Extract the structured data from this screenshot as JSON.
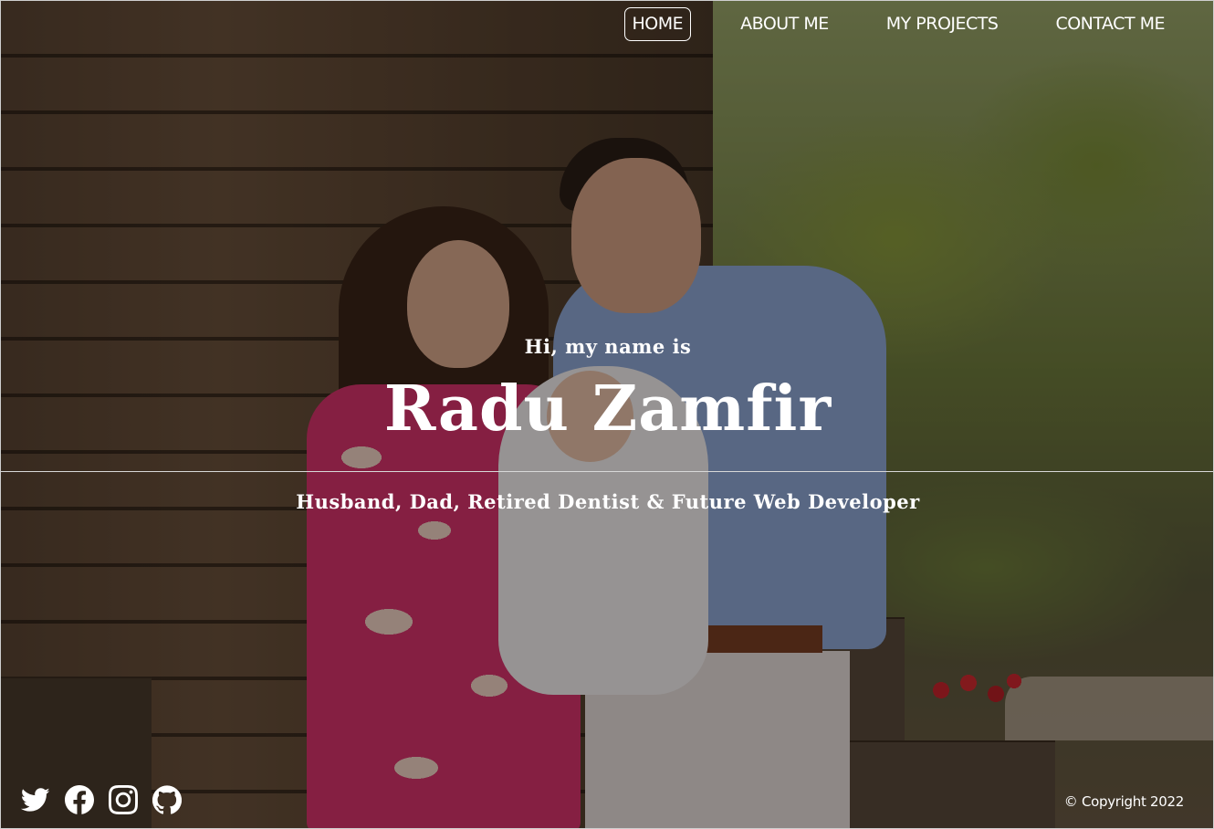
{
  "nav": {
    "items": [
      {
        "label": "HOME",
        "active": true
      },
      {
        "label": "ABOUT ME",
        "active": false
      },
      {
        "label": "MY PROJECTS",
        "active": false
      },
      {
        "label": "CONTACT ME",
        "active": false
      }
    ]
  },
  "hero": {
    "greeting": "Hi, my name is",
    "name": "Radu Zamfir",
    "tagline": "Husband, Dad, Retired Dentist & Future Web Developer"
  },
  "social": {
    "icons": [
      "twitter-icon",
      "facebook-icon",
      "instagram-icon",
      "github-icon"
    ]
  },
  "footer": {
    "copyright": "© Copyright 2022"
  },
  "colors": {
    "text": "#ffffff",
    "overlay": "rgba(0,0,0,0.38)"
  }
}
